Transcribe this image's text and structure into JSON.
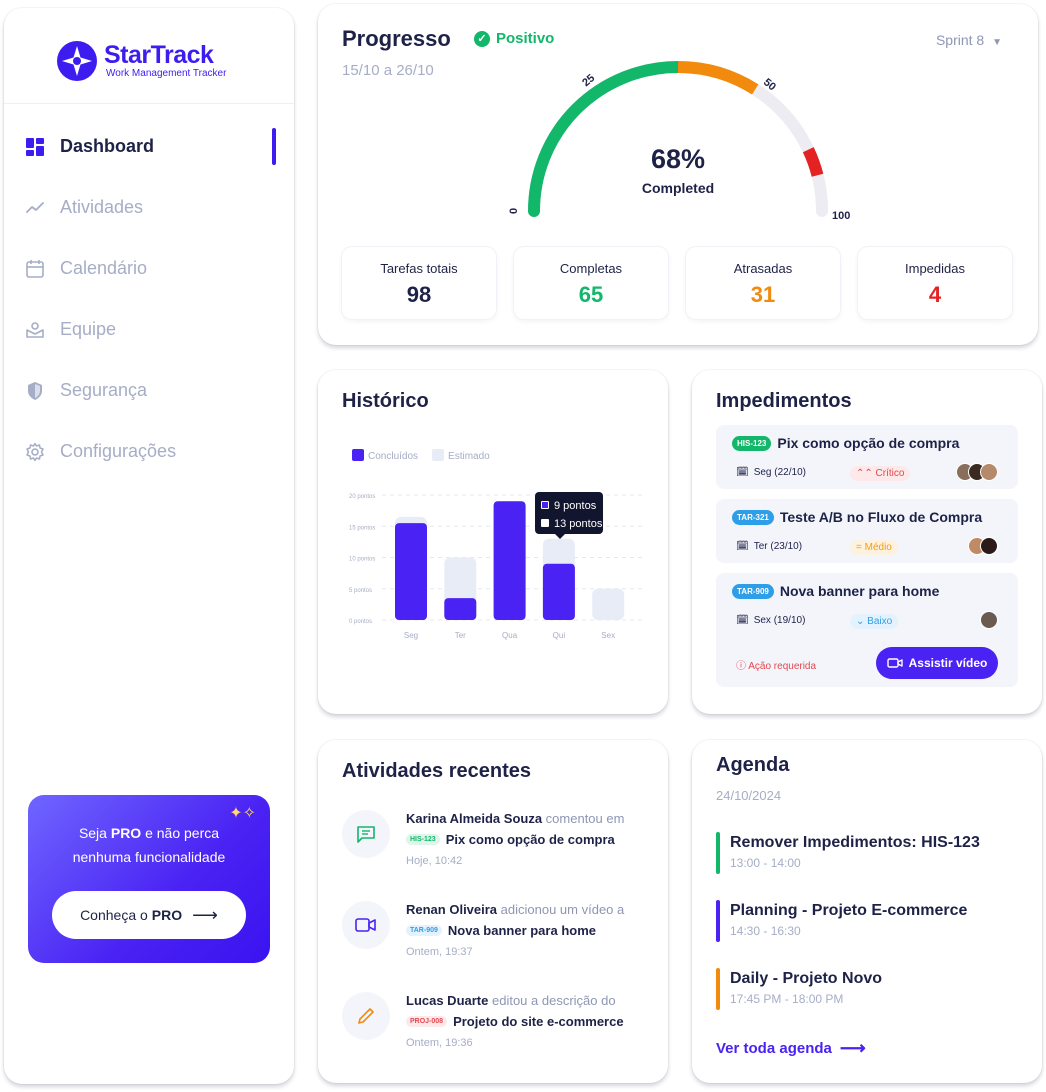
{
  "brand": {
    "name": "StarTrack",
    "tagline": "Work Management Tracker",
    "color": "#3d1cf0"
  },
  "sidebar": {
    "items": [
      {
        "label": "Dashboard",
        "icon": "dashboard-icon",
        "active": true
      },
      {
        "label": "Atividades",
        "icon": "trend-icon",
        "active": false
      },
      {
        "label": "Calendário",
        "icon": "calendar-icon",
        "active": false
      },
      {
        "label": "Equipe",
        "icon": "team-icon",
        "active": false
      },
      {
        "label": "Segurança",
        "icon": "shield-icon",
        "active": false
      },
      {
        "label": "Configurações",
        "icon": "gear-icon",
        "active": false
      }
    ],
    "promo": {
      "line1_a": "Seja ",
      "line1_b": "PRO",
      "line1_c": " e não perca",
      "line2": "nenhuma funcionalidade",
      "button_a": "Conheça o",
      "button_b": "PRO"
    }
  },
  "progress": {
    "title": "Progresso",
    "status": "Positivo",
    "dates": "15/10 a 26/10",
    "sprint": "Sprint 8",
    "gauge": {
      "value": 68,
      "percent_label": "68%",
      "label": "Completed",
      "ticks": [
        "0",
        "25",
        "50",
        "100"
      ]
    },
    "stats": [
      {
        "label": "Tarefas totais",
        "value": "98",
        "color": "#1e2247"
      },
      {
        "label": "Completas",
        "value": "65",
        "color": "#12b76a"
      },
      {
        "label": "Atrasadas",
        "value": "31",
        "color": "#f28a0d"
      },
      {
        "label": "Impedidas",
        "value": "4",
        "color": "#e52222"
      }
    ]
  },
  "historico": {
    "title": "Histórico",
    "legend": [
      "Concluídos",
      "Estimado"
    ],
    "tooltip": {
      "done": "9 pontos",
      "estimated": "13 pontos"
    }
  },
  "chart_data": {
    "type": "bar",
    "categories": [
      "Seg",
      "Ter",
      "Qua",
      "Qui",
      "Sex"
    ],
    "series": [
      {
        "name": "Concluídos",
        "values": [
          15.5,
          3.5,
          19,
          9,
          0
        ],
        "color": "#4a22f3"
      },
      {
        "name": "Estimado",
        "values": [
          16.5,
          10,
          19,
          13,
          5
        ],
        "color": "#e8ecf6"
      }
    ],
    "ylim": [
      0,
      20
    ],
    "yticks": [
      "0 pontos",
      "5 pontos",
      "10 pontos",
      "15 pontos",
      "20 pontos"
    ],
    "grid": true,
    "legend": "top-left"
  },
  "impedimentos": {
    "title": "Impedimentos",
    "items": [
      {
        "tag": "HIS-123",
        "tag_color": "green",
        "title": "Pix como opção de compra",
        "date": "Seg (22/10)",
        "priority": "Crítico",
        "prio_class": "crit"
      },
      {
        "tag": "TAR-321",
        "tag_color": "blue",
        "title": "Teste A/B no Fluxo de Compra",
        "date": "Ter (23/10)",
        "priority": "Médio",
        "prio_class": "med"
      },
      {
        "tag": "TAR-909",
        "tag_color": "blue",
        "title": "Nova banner para home",
        "date": "Sex (19/10)",
        "priority": "Baixo",
        "prio_class": "low",
        "action": "Ação requerida",
        "button": "Assistir vídeo"
      }
    ]
  },
  "atividades": {
    "title": "Atividades recentes",
    "items": [
      {
        "name": "Karina Almeida Souza",
        "verb": " comentou em",
        "tag": "HIS-123",
        "tag_class": "mt-green",
        "target": "Pix como opção de compra",
        "time": "Hoje, 10:42",
        "icon": "comment-icon",
        "icon_color": "#12b76a"
      },
      {
        "name": "Renan Oliveira",
        "verb": " adicionou um vídeo a",
        "tag": "TAR-909",
        "tag_class": "mt-blue",
        "target": "Nova banner para home",
        "time": "Ontem, 19:37",
        "icon": "video-icon",
        "icon_color": "#4a22f3"
      },
      {
        "name": "Lucas Duarte",
        "verb": " editou a descrição do",
        "tag": "PROJ-008",
        "tag_class": "mt-red",
        "target": "Projeto do site e-commerce",
        "time": "Ontem, 19:36",
        "icon": "pencil-icon",
        "icon_color": "#f28a0d"
      }
    ]
  },
  "agenda": {
    "title": "Agenda",
    "date": "24/10/2024",
    "items": [
      {
        "title": "Remover Impedimentos: HIS-123",
        "time": "13:00 - 14:00",
        "color": "#12b76a"
      },
      {
        "title": "Planning - Projeto E-commerce",
        "time": "14:30 - 16:30",
        "color": "#4a22f3"
      },
      {
        "title": "Daily - Projeto Novo",
        "time": "17:45 PM - 18:00 PM",
        "color": "#f28a0d"
      }
    ],
    "link": "Ver toda agenda"
  }
}
